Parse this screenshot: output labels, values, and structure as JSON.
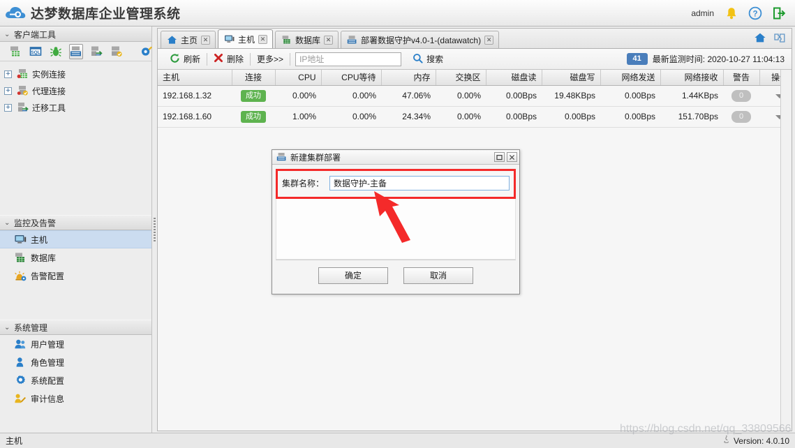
{
  "header": {
    "title": "达梦数据库企业管理系统",
    "user": "admin",
    "logo_icon": "cloud-icon",
    "bell_icon": "bell-icon",
    "help_icon": "help-icon",
    "logout_icon": "logout-icon",
    "accent_color": "#3d8fd4"
  },
  "sidebar": {
    "sections": [
      {
        "title": "客户端工具",
        "chevron": "⌄"
      },
      {
        "title": "监控及告警",
        "chevron": "⌄"
      },
      {
        "title": "系统管理",
        "chevron": "⌄"
      }
    ],
    "toolbar_icons": [
      "database-server-icon",
      "sql-icon",
      "debug-bug-icon",
      "cluster-icon",
      "migrate-icon",
      "agent-check-icon",
      "settings-gear-icon"
    ],
    "tree": [
      {
        "label": "实例连接",
        "expander": "+",
        "icon": "instance-connection-icon"
      },
      {
        "label": "代理连接",
        "expander": "+",
        "icon": "agent-connection-icon"
      },
      {
        "label": "迁移工具",
        "expander": "+",
        "icon": "migration-tool-icon"
      }
    ],
    "monitor_items": [
      {
        "label": "主机",
        "icon": "host-icon",
        "active": true
      },
      {
        "label": "数据库",
        "icon": "database-icon",
        "active": false
      },
      {
        "label": "告警配置",
        "icon": "alarm-config-icon",
        "active": false
      }
    ],
    "system_items": [
      {
        "label": "用户管理",
        "icon": "users-icon"
      },
      {
        "label": "角色管理",
        "icon": "role-icon"
      },
      {
        "label": "系统配置",
        "icon": "gear-icon"
      },
      {
        "label": "审计信息",
        "icon": "audit-icon"
      }
    ]
  },
  "tabs": [
    {
      "label": "主页",
      "icon": "home-icon",
      "active": false,
      "close": "✕"
    },
    {
      "label": "主机",
      "icon": "host-icon",
      "active": true,
      "close": "✕"
    },
    {
      "label": "数据库",
      "icon": "database-icon",
      "active": false,
      "close": "✕"
    },
    {
      "label": "部署数据守护v4.0-1-(datawatch)",
      "icon": "cluster-icon",
      "active": false,
      "close": "✕"
    }
  ],
  "tabbar_right": {
    "home_icon": "home-icon",
    "plugin_icon": "puzzle-icon"
  },
  "toolbar": {
    "refresh_label": "刷新",
    "delete_label": "删除",
    "more_label": "更多>>",
    "ip_placeholder": "IP地址",
    "ip_value": "",
    "search_label": "搜索",
    "count_badge": "41",
    "monitor_time": "最新监测时间: 2020-10-27 11:04:13"
  },
  "table": {
    "columns": [
      "主机",
      "连接",
      "CPU",
      "CPU等待",
      "内存",
      "交换区",
      "磁盘读",
      "磁盘写",
      "网络发送",
      "网络接收",
      "警告",
      "操作"
    ],
    "rows": [
      {
        "host": "192.168.1.32",
        "conn": "成功",
        "cpu": "0.00%",
        "cpu_wait": "0.00%",
        "mem": "47.06%",
        "swap": "0.00%",
        "disk_read": "0.00Bps",
        "disk_write": "19.48KBps",
        "net_send": "0.00Bps",
        "net_recv": "1.44KBps",
        "warn": "0",
        "action": "▾"
      },
      {
        "host": "192.168.1.60",
        "conn": "成功",
        "cpu": "1.00%",
        "cpu_wait": "0.00%",
        "mem": "24.34%",
        "swap": "0.00%",
        "disk_read": "0.00Bps",
        "disk_write": "0.00Bps",
        "net_send": "0.00Bps",
        "net_recv": "151.70Bps",
        "warn": "0",
        "action": "▾"
      }
    ],
    "ok_color": "#5eb34f",
    "badge_color": "#bfbfbf"
  },
  "dialog": {
    "title": "新建集群部署",
    "icon": "cluster-icon",
    "maximize": "❐",
    "close": "✕",
    "field_label": "集群名称：",
    "field_value": "数据守护-主备",
    "confirm_label": "确定",
    "cancel_label": "取消",
    "highlight_color": "#f42a2a"
  },
  "annotation": {
    "arrow_color": "#f42a2a"
  },
  "statusbar": {
    "left_text": "主机",
    "version": "Version: 4.0.10",
    "icon": "java-icon"
  },
  "watermark": {
    "text": "https://blog.csdn.net/qq_33809566"
  }
}
